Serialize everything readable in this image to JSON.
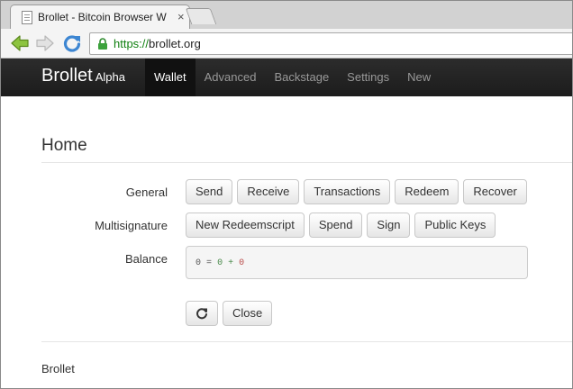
{
  "browser": {
    "tab_title": "Brollet - Bitcoin Browser W",
    "tab_close": "×",
    "url_proto": "https://",
    "url_host": "brollet.org"
  },
  "navbar": {
    "brand": "Brollet",
    "brand_sub": "Alpha",
    "items": [
      {
        "label": "Wallet",
        "active": true
      },
      {
        "label": "Advanced"
      },
      {
        "label": "Backstage"
      },
      {
        "label": "Settings"
      },
      {
        "label": "New"
      }
    ]
  },
  "page": {
    "title": "Home",
    "general_label": "General",
    "general_buttons": [
      "Send",
      "Receive",
      "Transactions",
      "Redeem",
      "Recover"
    ],
    "multisig_label": "Multisignature",
    "multisig_buttons": [
      "New Redeemscript",
      "Spend",
      "Sign",
      "Public Keys"
    ],
    "balance_label": "Balance",
    "balance": {
      "total": "0",
      "eq": "=",
      "confirmed": "0",
      "plus": "+",
      "unconfirmed": "0"
    },
    "close_label": "Close",
    "footer": "Brollet"
  },
  "colors": {
    "navbar": "#222222",
    "positive": "#468847",
    "negative": "#b94a48",
    "https": "#108010"
  }
}
